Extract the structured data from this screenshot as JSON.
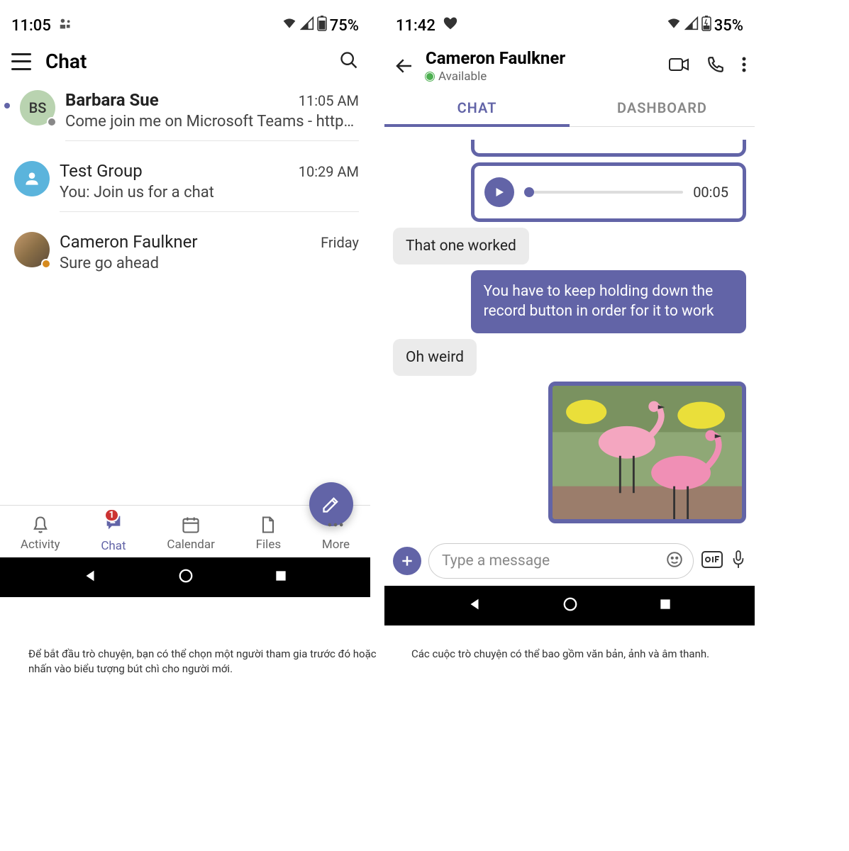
{
  "phone1": {
    "status": {
      "time": "11:05",
      "battery": "75%"
    },
    "header": {
      "title": "Chat"
    },
    "chats": [
      {
        "name": "Barbara Sue",
        "time": "11:05 AM",
        "preview": "Come join me on Microsoft Teams - http…",
        "initials": "BS"
      },
      {
        "name": "Test Group",
        "time": "10:29 AM",
        "preview": "You: Join us for a chat"
      },
      {
        "name": "Cameron Faulkner",
        "time": "Friday",
        "preview": "Sure go ahead"
      }
    ],
    "nav": {
      "activity": "Activity",
      "chat": "Chat",
      "calendar": "Calendar",
      "files": "Files",
      "more": "More",
      "badge": "1"
    }
  },
  "phone2": {
    "status": {
      "time": "11:42",
      "battery": "35%"
    },
    "header": {
      "name": "Cameron Faulkner",
      "status": "Available"
    },
    "tabs": {
      "chat": "CHAT",
      "dashboard": "DASHBOARD"
    },
    "audio": {
      "duration": "00:05"
    },
    "messages": {
      "in1": "That one worked",
      "out1": "You have to keep holding down the record button in order for it to work",
      "in2": "Oh weird"
    },
    "input": {
      "placeholder": "Type a message"
    }
  },
  "captions": {
    "c1": "Để bắt đầu trò chuyện, bạn có thể chọn một người tham gia trước đó hoặc nhấn vào biểu tượng bút chì cho người mới.",
    "c2": "Các cuộc trò chuyện có thể bao gồm văn bản, ảnh và âm thanh."
  }
}
